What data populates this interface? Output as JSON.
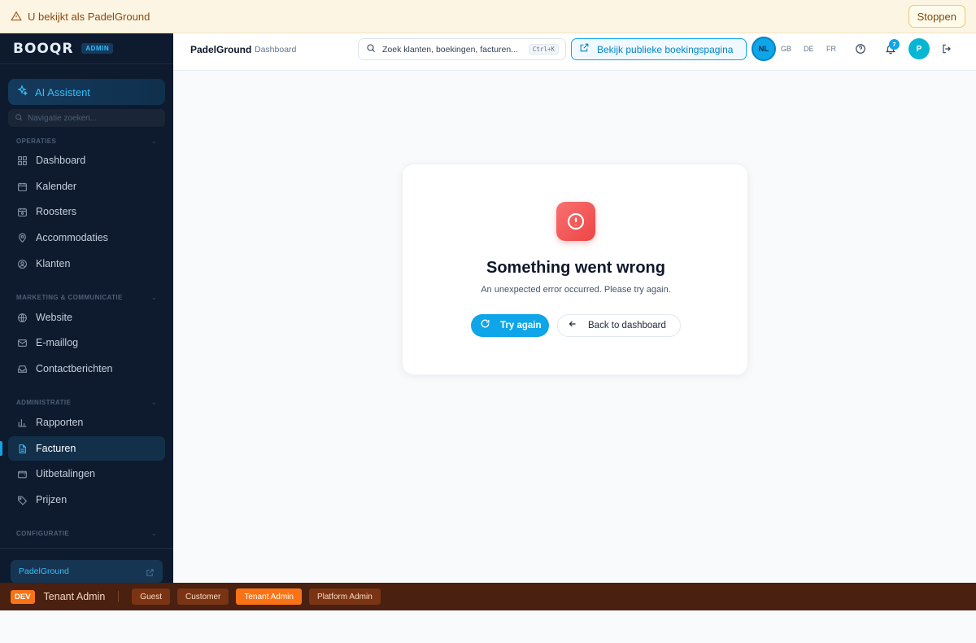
{
  "banner": {
    "text": "U bekijkt als PadelGround",
    "stop_label": "Stoppen"
  },
  "sidebar": {
    "logo": "BOOQR",
    "admin_badge": "ADMIN",
    "ai_assistant": "AI Assistent",
    "search_placeholder": "Navigatie zoeken...",
    "sections": {
      "operations": "OPERATIES",
      "marketing": "MARKETING & COMMUNICATIE",
      "administration": "ADMINISTRATIE",
      "configuration": "CONFIGURATIE"
    },
    "items": {
      "dashboard": "Dashboard",
      "calendar": "Kalender",
      "schedules": "Roosters",
      "accommodations": "Accommodaties",
      "customers": "Klanten",
      "website": "Website",
      "email_log": "E-maillog",
      "contact_messages": "Contactberichten",
      "reports": "Rapporten",
      "invoices": "Facturen",
      "payouts": "Uitbetalingen",
      "prices": "Prijzen"
    },
    "active_item": "Facturen",
    "tenant": "PadelGround"
  },
  "header": {
    "title": "PadelGround",
    "subtitle": "Dashboard",
    "search_placeholder": "Zoek klanten, boekingen, facturen...",
    "shortcut": "Ctrl+K",
    "public_page_label": "Bekijk publieke boekingspagina",
    "languages": [
      "NL",
      "GB",
      "DE",
      "FR"
    ],
    "active_language": "NL",
    "notification_count": "7",
    "avatar_initial": "P"
  },
  "error": {
    "title": "Something went wrong",
    "message": "An unexpected error occurred. Please try again.",
    "retry_label": "Try again",
    "back_label": "Back to dashboard"
  },
  "dev_bar": {
    "tag": "DEV",
    "current_role": "Tenant Admin",
    "roles": [
      "Guest",
      "Customer",
      "Tenant Admin",
      "Platform Admin"
    ],
    "active_role": "Tenant Admin"
  },
  "colors": {
    "accent": "#0ea5e9",
    "sidebar_bg": "#0e1b2e",
    "error": "#ef4444",
    "dev_bar": "#4a2010",
    "dev_accent": "#f97316"
  }
}
